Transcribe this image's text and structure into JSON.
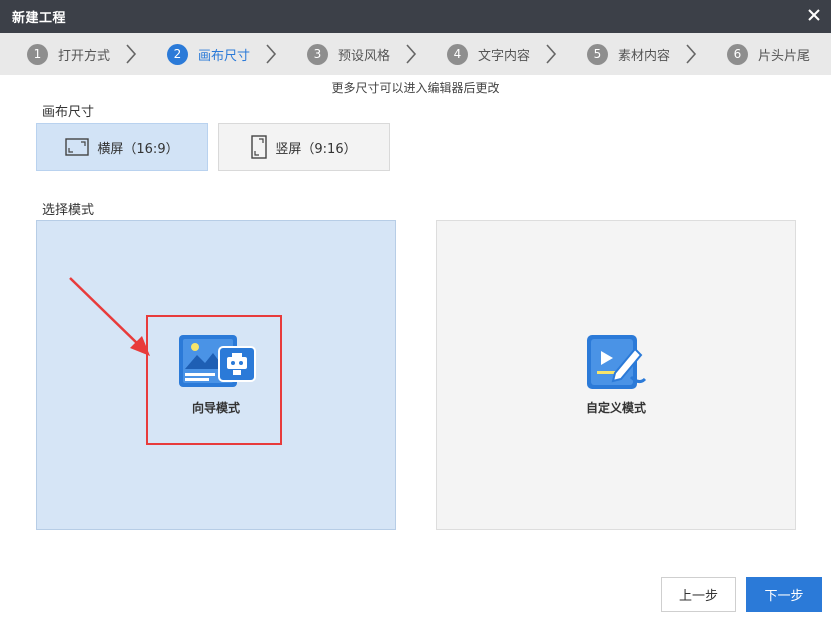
{
  "window": {
    "title": "新建工程",
    "close_icon": "close-icon"
  },
  "steps": [
    {
      "num": "1",
      "label": "打开方式",
      "active": false
    },
    {
      "num": "2",
      "label": "画布尺寸",
      "active": true
    },
    {
      "num": "3",
      "label": "预设风格",
      "active": false
    },
    {
      "num": "4",
      "label": "文字内容",
      "active": false
    },
    {
      "num": "5",
      "label": "素材内容",
      "active": false
    },
    {
      "num": "6",
      "label": "片头片尾",
      "active": false
    }
  ],
  "hint": "更多尺寸可以进入编辑器后更改",
  "canvas_size": {
    "label": "画布尺寸",
    "options": [
      {
        "label": "横屏（16:9）",
        "icon": "landscape-icon",
        "selected": true
      },
      {
        "label": "竖屏（9:16）",
        "icon": "portrait-icon",
        "selected": false
      }
    ]
  },
  "mode": {
    "label": "选择模式",
    "options": [
      {
        "label": "向导模式",
        "icon": "wizard-mode-icon",
        "selected": true
      },
      {
        "label": "自定义模式",
        "icon": "custom-mode-icon",
        "selected": false
      }
    ]
  },
  "footer": {
    "prev_label": "上一步",
    "next_label": "下一步"
  },
  "colors": {
    "accent": "#2b7ad8",
    "titlebar": "#3c4048",
    "selected_bg": "#d6e5f6",
    "annotation_red": "#e83b3b"
  }
}
